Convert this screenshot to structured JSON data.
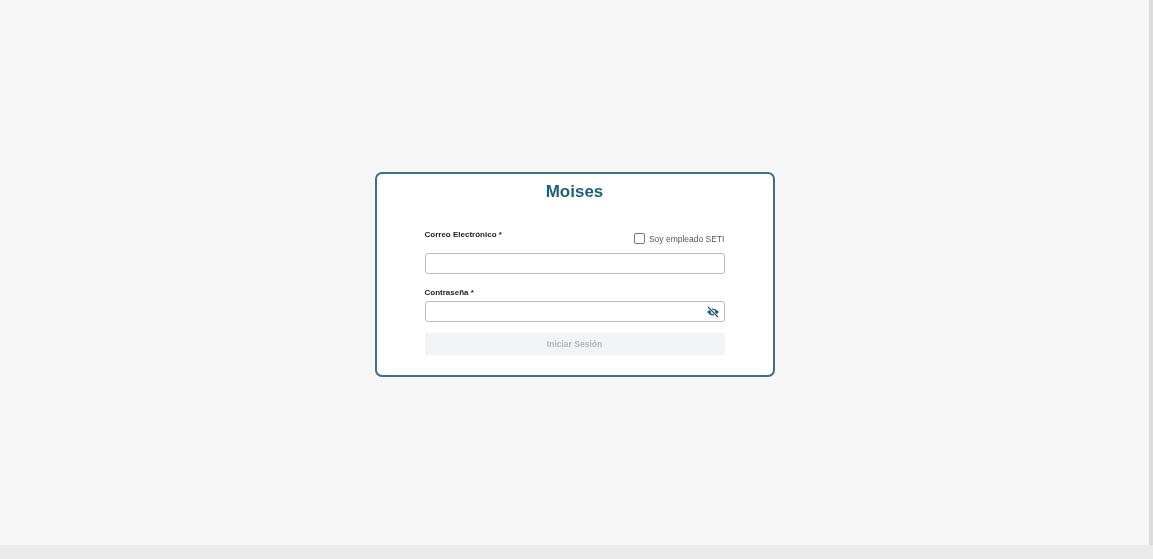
{
  "title": "Moises",
  "email": {
    "label": "Correo Electrónico",
    "required": "*"
  },
  "employee_checkbox": {
    "label": "Soy empleado SETI",
    "checked": false
  },
  "password": {
    "label": "Contraseña",
    "required": "*"
  },
  "submit": {
    "label": "Iniciar Sesión",
    "disabled": true
  }
}
